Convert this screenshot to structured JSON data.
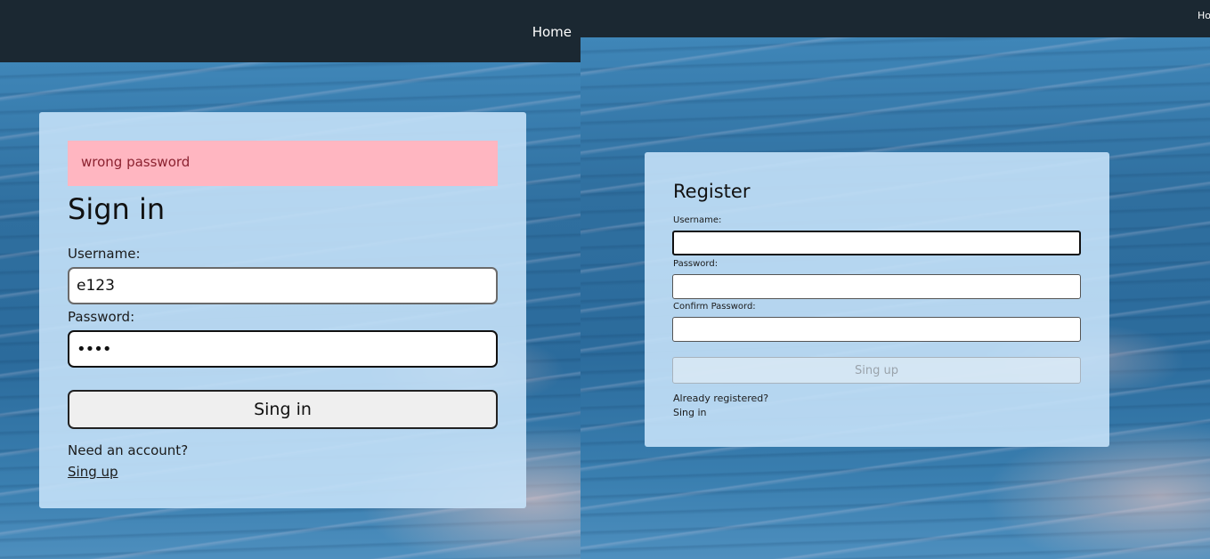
{
  "left": {
    "nav": {
      "home_label": "Home"
    },
    "alert": {
      "message": "wrong password"
    },
    "form": {
      "title": "Sign in",
      "username_label": "Username:",
      "username_value": "e123",
      "password_label": "Password:",
      "password_value": "••••",
      "submit_label": "Sing in",
      "need_account_text": "Need an account?",
      "signup_link": "Sing up"
    }
  },
  "right": {
    "nav": {
      "home_label": "Home"
    },
    "form": {
      "title": "Register",
      "username_label": "Username:",
      "password_label": "Password:",
      "confirm_password_label": "Confirm Password:",
      "submit_label": "Sing up",
      "already_registered_text": "Already registered?",
      "signin_link": "Sing in"
    }
  },
  "colors": {
    "navbar": "#1b2832",
    "card": "#c4e1f8",
    "alert_bg": "#ffb6c1",
    "alert_text": "#8b2230"
  }
}
